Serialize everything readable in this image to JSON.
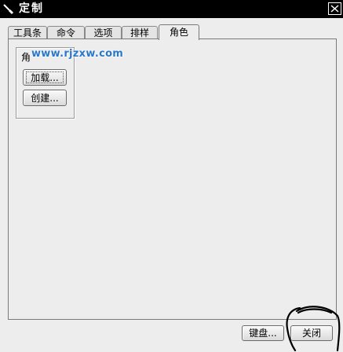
{
  "window": {
    "title": "定制"
  },
  "tabs": [
    {
      "label": "工具条"
    },
    {
      "label": "命令"
    },
    {
      "label": "选项"
    },
    {
      "label": "排样"
    },
    {
      "label": "角色"
    }
  ],
  "roles_group": {
    "label": "角",
    "load_label": "加载...",
    "create_label": "创建..."
  },
  "watermark": "www.rjzxw.com",
  "footer": {
    "keyboard_label": "键盘...",
    "close_label": "关闭"
  }
}
